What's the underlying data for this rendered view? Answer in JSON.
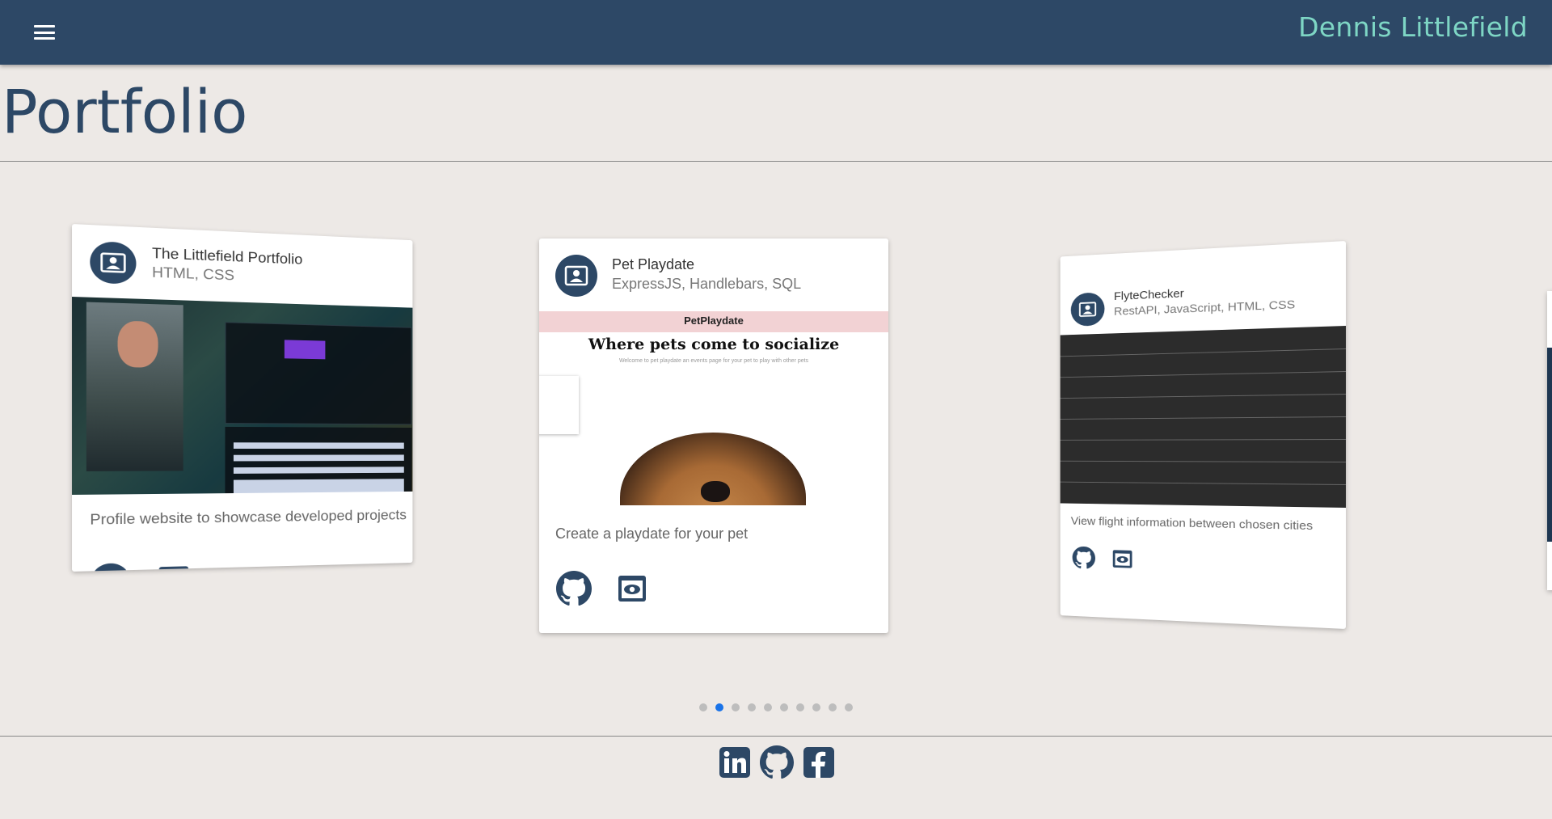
{
  "header": {
    "brand": "Dennis Littlefield",
    "menu_icon": "hamburger-menu-icon"
  },
  "page": {
    "title": "Portfolio"
  },
  "carousel": {
    "cards": [
      {
        "title": "The Littlefield Portfolio",
        "tech": "HTML, CSS",
        "description": "Profile website to showcase developed projects",
        "icons": [
          "github-icon",
          "preview-eye-icon"
        ]
      },
      {
        "title": "Pet Playdate",
        "tech": "ExpressJS, Handlebars, SQL",
        "description": "Create a playdate for your pet",
        "icons": [
          "github-icon",
          "preview-eye-icon"
        ],
        "screenshot": {
          "brand": "PetPlaydate",
          "headline": "Where pets come to socialize",
          "tagline": "Welcome to pet playdate an events page for your pet to play with other pets"
        }
      },
      {
        "title": "FlyteChecker",
        "tech": "RestAPI, JavaScript, HTML, CSS",
        "description": "View flight information between chosen cities",
        "icons": [
          "github-icon",
          "preview-eye-icon"
        ]
      }
    ],
    "pagination": {
      "total": 10,
      "active_index": 1
    }
  },
  "footer": {
    "icons": [
      "linkedin-icon",
      "github-icon",
      "facebook-icon"
    ]
  },
  "colors": {
    "navbar": "#2d4866",
    "brand_text": "#7ed6c5",
    "background": "#ede9e6",
    "active_dot": "#1a73e8"
  }
}
